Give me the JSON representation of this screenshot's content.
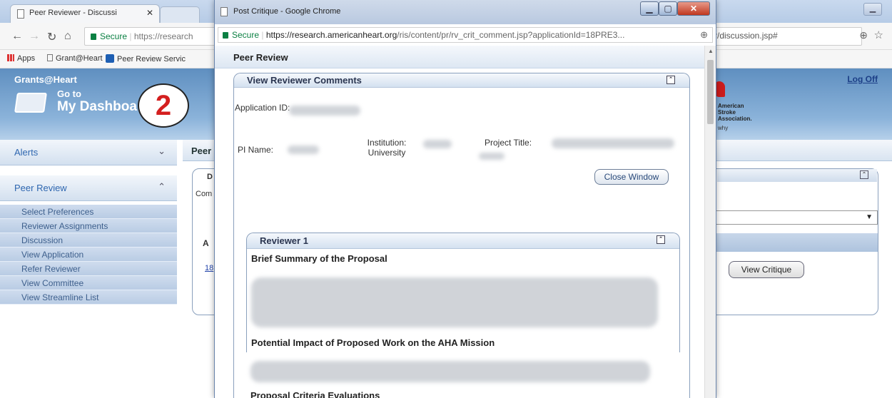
{
  "bg_browser": {
    "tab_title": "Peer Reviewer - Discussi",
    "omni_secure": "Secure",
    "omni_url": "https://research",
    "url_right": "r/discussion.jsp#",
    "bookmarks": [
      "Apps",
      "Grant@Heart",
      "Peer Review Servic"
    ]
  },
  "site": {
    "brand": "Grants@Heart",
    "goto": "Go to",
    "dashboard": "My Dashboa",
    "logoff": "Log Off",
    "aha_logo": "American\nStroke\nAssociation.",
    "aha_tag": "why"
  },
  "callout": "2",
  "sidebar": {
    "alerts": "Alerts",
    "peer_review": "Peer Review",
    "links": [
      "Select Preferences",
      "Reviewer Assignments",
      "Discussion",
      "View Application",
      "Refer Reviewer",
      "View Committee",
      "View Streamline List"
    ]
  },
  "main": {
    "tab_fragment": "Peer",
    "fragments": {
      "d": "D",
      "com": "Com",
      "a": "A",
      "link": "18"
    },
    "view_critique": "View Critique"
  },
  "popup": {
    "window_title": "Post Critique - Google Chrome",
    "omni_secure": "Secure",
    "omni_host": "https://research.americanheart.org",
    "omni_path": "/ris/content/pr/rv_crit_comment.jsp?applicationId=18PRE3...",
    "page_heading": "Peer Review",
    "panel_title": "View Reviewer Comments",
    "labels": {
      "application_id": "Application ID:",
      "pi_name": "PI Name:",
      "institution": "Institution:",
      "institution_value": "University",
      "project_title": "Project Title:"
    },
    "close_window": "Close Window",
    "reviewer_title": "Reviewer 1",
    "sections": [
      "Brief Summary of the Proposal",
      "Potential Impact of Proposed Work on the AHA Mission",
      "Proposal Criteria Evaluations"
    ]
  },
  "colors": {
    "header_blue": "#6f9bc8",
    "callout_red": "#d41f1f",
    "link_blue": "#2f67b0"
  }
}
